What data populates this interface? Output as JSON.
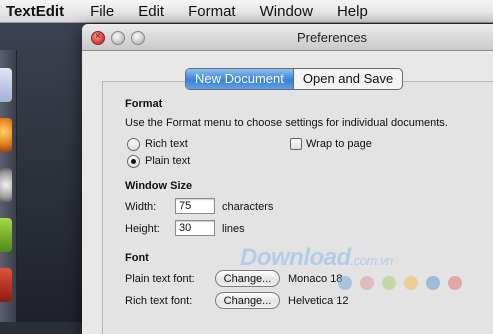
{
  "menubar": {
    "app": "TextEdit",
    "items": [
      "File",
      "Edit",
      "Format",
      "Window",
      "Help"
    ]
  },
  "window": {
    "title": "Preferences",
    "tabs": [
      "New Document",
      "Open and Save"
    ],
    "active_tab": "New Document"
  },
  "format": {
    "heading": "Format",
    "description": "Use the Format menu to choose settings for individual documents.",
    "rich_text_label": "Rich text",
    "plain_text_label": "Plain text",
    "wrap_label": "Wrap to page",
    "selected": "Plain text",
    "wrap_checked": false
  },
  "window_size": {
    "heading": "Window Size",
    "width_label": "Width:",
    "width_value": "75",
    "width_unit": "characters",
    "height_label": "Height:",
    "height_value": "30",
    "height_unit": "lines"
  },
  "font": {
    "heading": "Font",
    "plain_label": "Plain text font:",
    "plain_button": "Change...",
    "plain_value": "Monaco 18",
    "rich_label": "Rich text font:",
    "rich_button": "Change...",
    "rich_value": "Helvetica 12"
  },
  "watermark": {
    "text": "Download",
    "suffix": ".com.vn",
    "dot_colors": [
      "#7fb0e0",
      "#e0a0a0",
      "#b0d080",
      "#f0c060",
      "#70a0d0",
      "#e08080"
    ]
  },
  "colors": {
    "accent": "#3a82d8"
  }
}
